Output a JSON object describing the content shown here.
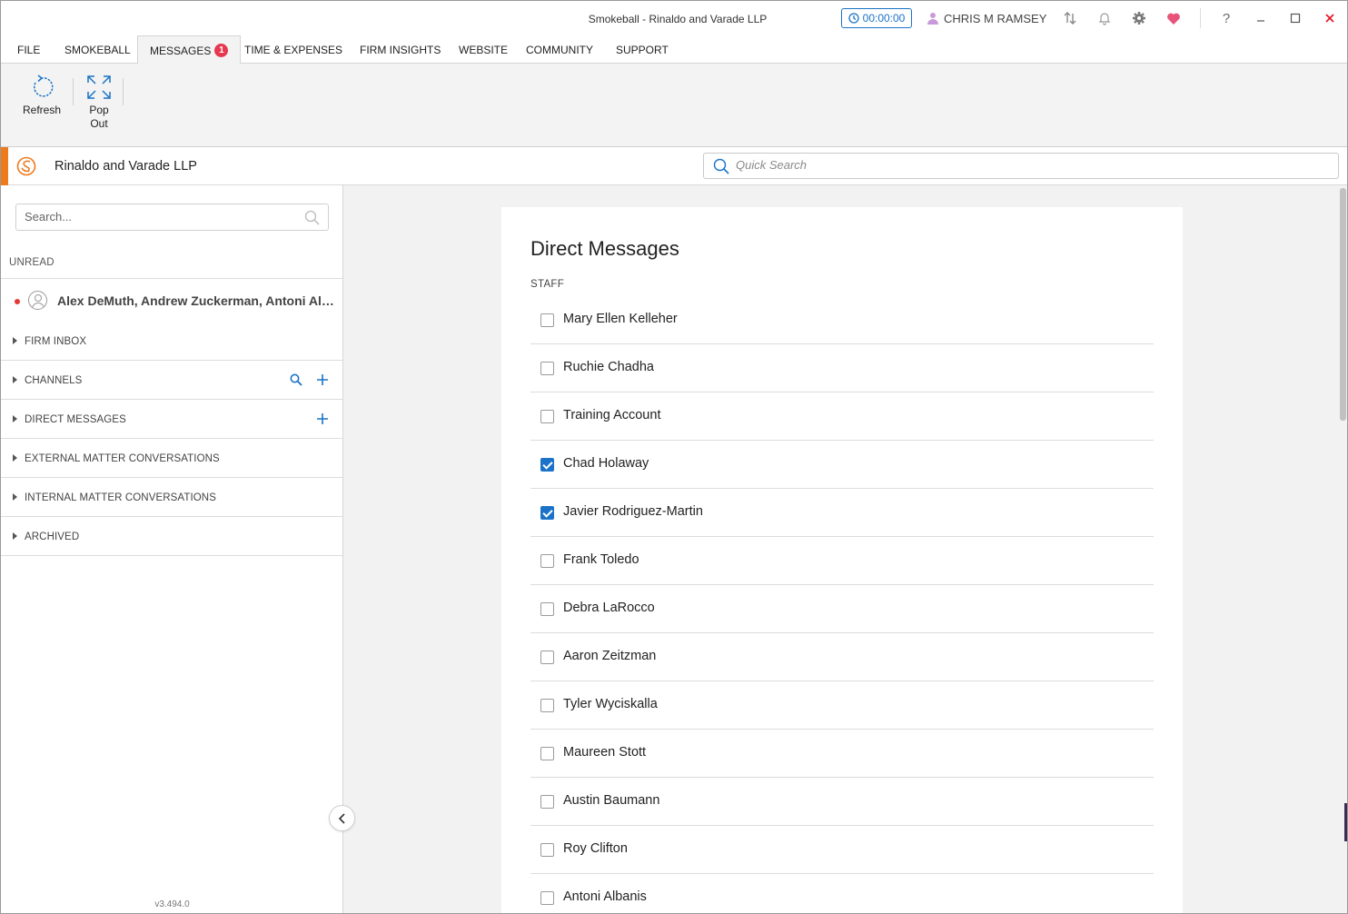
{
  "window": {
    "title": "Smokeball  - Rinaldo and Varade LLP",
    "timer": "00:00:00",
    "user": "CHRIS M RAMSEY"
  },
  "menu": {
    "items": [
      {
        "label": "FILE"
      },
      {
        "label": "SMOKEBALL"
      },
      {
        "label": "MESSAGES",
        "badge": "1",
        "active": true
      },
      {
        "label": "TIME & EXPENSES"
      },
      {
        "label": "FIRM INSIGHTS"
      },
      {
        "label": "WEBSITE"
      },
      {
        "label": "COMMUNITY"
      },
      {
        "label": "SUPPORT"
      }
    ]
  },
  "ribbon": {
    "refresh_label": "Refresh",
    "popout_label": "Pop Out"
  },
  "firm": {
    "name": "Rinaldo and Varade LLP",
    "quick_search_placeholder": "Quick Search",
    "accent_color": "#ee7a1e"
  },
  "sidebar": {
    "search_placeholder": "Search...",
    "unread_label": "UNREAD",
    "unread_item": "Alex DeMuth, Andrew Zuckerman, Antoni Albanis",
    "sections": [
      {
        "label": "FIRM INBOX"
      },
      {
        "label": "CHANNELS"
      },
      {
        "label": "DIRECT MESSAGES"
      },
      {
        "label": "EXTERNAL MATTER CONVERSATIONS"
      },
      {
        "label": "INTERNAL MATTER CONVERSATIONS"
      },
      {
        "label": "ARCHIVED"
      }
    ],
    "version": "v3.494.0"
  },
  "main": {
    "title": "Direct Messages",
    "staff_label": "STAFF",
    "staff": [
      {
        "name": "Mary Ellen Kelleher",
        "checked": false
      },
      {
        "name": "Ruchie Chadha",
        "checked": false
      },
      {
        "name": "Training Account",
        "checked": false
      },
      {
        "name": "Chad Holaway",
        "checked": true
      },
      {
        "name": "Javier Rodriguez-Martin",
        "checked": true
      },
      {
        "name": "Frank Toledo",
        "checked": false
      },
      {
        "name": "Debra LaRocco",
        "checked": false
      },
      {
        "name": "Aaron Zeitzman",
        "checked": false
      },
      {
        "name": "Tyler Wyciskalla",
        "checked": false
      },
      {
        "name": "Maureen Stott",
        "checked": false
      },
      {
        "name": "Austin Baumann",
        "checked": false
      },
      {
        "name": "Roy Clifton",
        "checked": false
      },
      {
        "name": "Antoni Albanis",
        "checked": false
      }
    ]
  },
  "colors": {
    "primary": "#1a73c8",
    "badge": "#e53950",
    "close": "#e81123"
  }
}
